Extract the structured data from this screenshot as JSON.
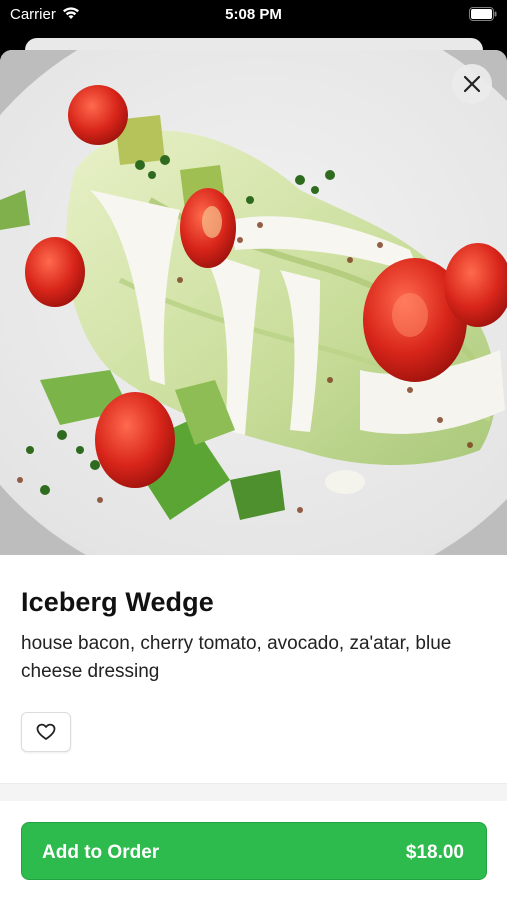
{
  "status_bar": {
    "carrier": "Carrier",
    "time": "5:08 PM",
    "icons": [
      "wifi-icon",
      "battery-icon"
    ]
  },
  "item": {
    "image_icon": "salad-photo",
    "title": "Iceberg Wedge",
    "description": "house bacon, cherry tomato, avocado, za'atar, blue cheese dressing"
  },
  "actions": {
    "close_icon": "close-icon",
    "favorite_icon": "heart-icon",
    "add_to_order_label": "Add to Order",
    "price": "$18.00"
  },
  "colors": {
    "accent": "#2dbb4d"
  }
}
